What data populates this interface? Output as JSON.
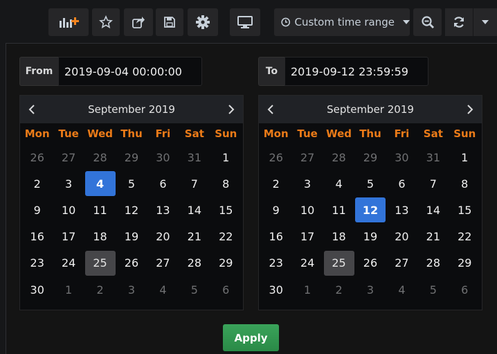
{
  "toolbar": {
    "add_panel_icon": "add-panel-icon",
    "star_icon": "star-icon",
    "share_icon": "share-icon",
    "save_icon": "save-icon",
    "settings_icon": "gear-icon",
    "tv_icon": "monitor-icon",
    "time_range_label": "Custom time range",
    "zoom_icon": "zoom-out-icon",
    "refresh_icon": "refresh-icon"
  },
  "range": {
    "from_label": "From",
    "from_value": "2019-09-04 00:00:00",
    "to_label": "To",
    "to_value": "2019-09-12 23:59:59"
  },
  "weekdays": [
    "Mon",
    "Tue",
    "Wed",
    "Thu",
    "Fri",
    "Sat",
    "Sun"
  ],
  "calendars": [
    {
      "title": "September 2019",
      "selected": "4",
      "today": "25",
      "weeks": [
        [
          "26",
          "27",
          "28",
          "29",
          "30",
          "31",
          "1"
        ],
        [
          "2",
          "3",
          "4",
          "5",
          "6",
          "7",
          "8"
        ],
        [
          "9",
          "10",
          "11",
          "12",
          "13",
          "14",
          "15"
        ],
        [
          "16",
          "17",
          "18",
          "19",
          "20",
          "21",
          "22"
        ],
        [
          "23",
          "24",
          "25",
          "26",
          "27",
          "28",
          "29"
        ],
        [
          "30",
          "1",
          "2",
          "3",
          "4",
          "5",
          "6"
        ]
      ]
    },
    {
      "title": "September 2019",
      "selected": "12",
      "today": "25",
      "weeks": [
        [
          "26",
          "27",
          "28",
          "29",
          "30",
          "31",
          "1"
        ],
        [
          "2",
          "3",
          "4",
          "5",
          "6",
          "7",
          "8"
        ],
        [
          "9",
          "10",
          "11",
          "12",
          "13",
          "14",
          "15"
        ],
        [
          "16",
          "17",
          "18",
          "19",
          "20",
          "21",
          "22"
        ],
        [
          "23",
          "24",
          "25",
          "26",
          "27",
          "28",
          "29"
        ],
        [
          "30",
          "1",
          "2",
          "3",
          "4",
          "5",
          "6"
        ]
      ]
    }
  ],
  "apply_label": "Apply",
  "colors": {
    "accent_selected": "#3274d9",
    "weekday": "#eb7b18",
    "apply": "#2f9a50"
  }
}
